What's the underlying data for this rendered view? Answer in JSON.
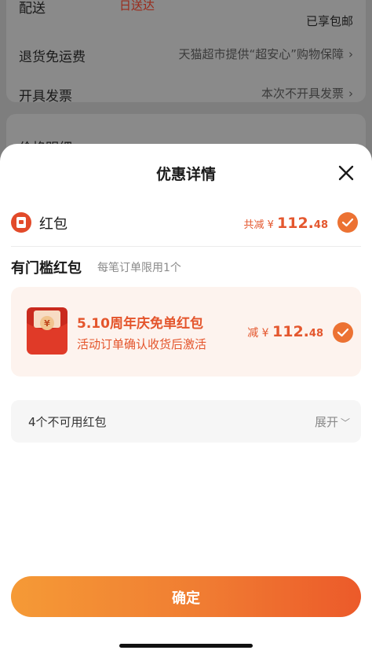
{
  "background": {
    "delivery_label": "配送",
    "delivery_value": "日送达",
    "coupon_note": "已享包邮",
    "rows": [
      {
        "label": "退货免运费",
        "value": "天猫超市提供“超安心”购物保障",
        "chevron": "›"
      },
      {
        "label": "开具发票",
        "value": "本次不开具发票",
        "chevron": "›"
      }
    ],
    "next_section": "价格明细"
  },
  "sheet": {
    "title": "优惠详情",
    "close_icon": "close-icon",
    "hongbao": {
      "label": "红包",
      "total_prefix": "共减 ¥ ",
      "total_int": "112.",
      "total_dec": "48",
      "checked": true
    },
    "section": {
      "title": "有门槛红包",
      "subtitle": "每笔订单限用1个"
    },
    "coupon": {
      "title": "5.10周年庆免单红包",
      "desc": "活动订单确认收货后激活",
      "amount_prefix": "减 ¥ ",
      "amount_int": "112.",
      "amount_dec": "48",
      "checked": true
    },
    "unavailable": {
      "label": "4个不可用红包",
      "toggle": "展开",
      "chevron": "﹀"
    },
    "confirm_label": "确定"
  },
  "colors": {
    "accent": "#ec7233",
    "coupon_text": "#e4552c",
    "coupon_bg": "#fdf3ee"
  }
}
